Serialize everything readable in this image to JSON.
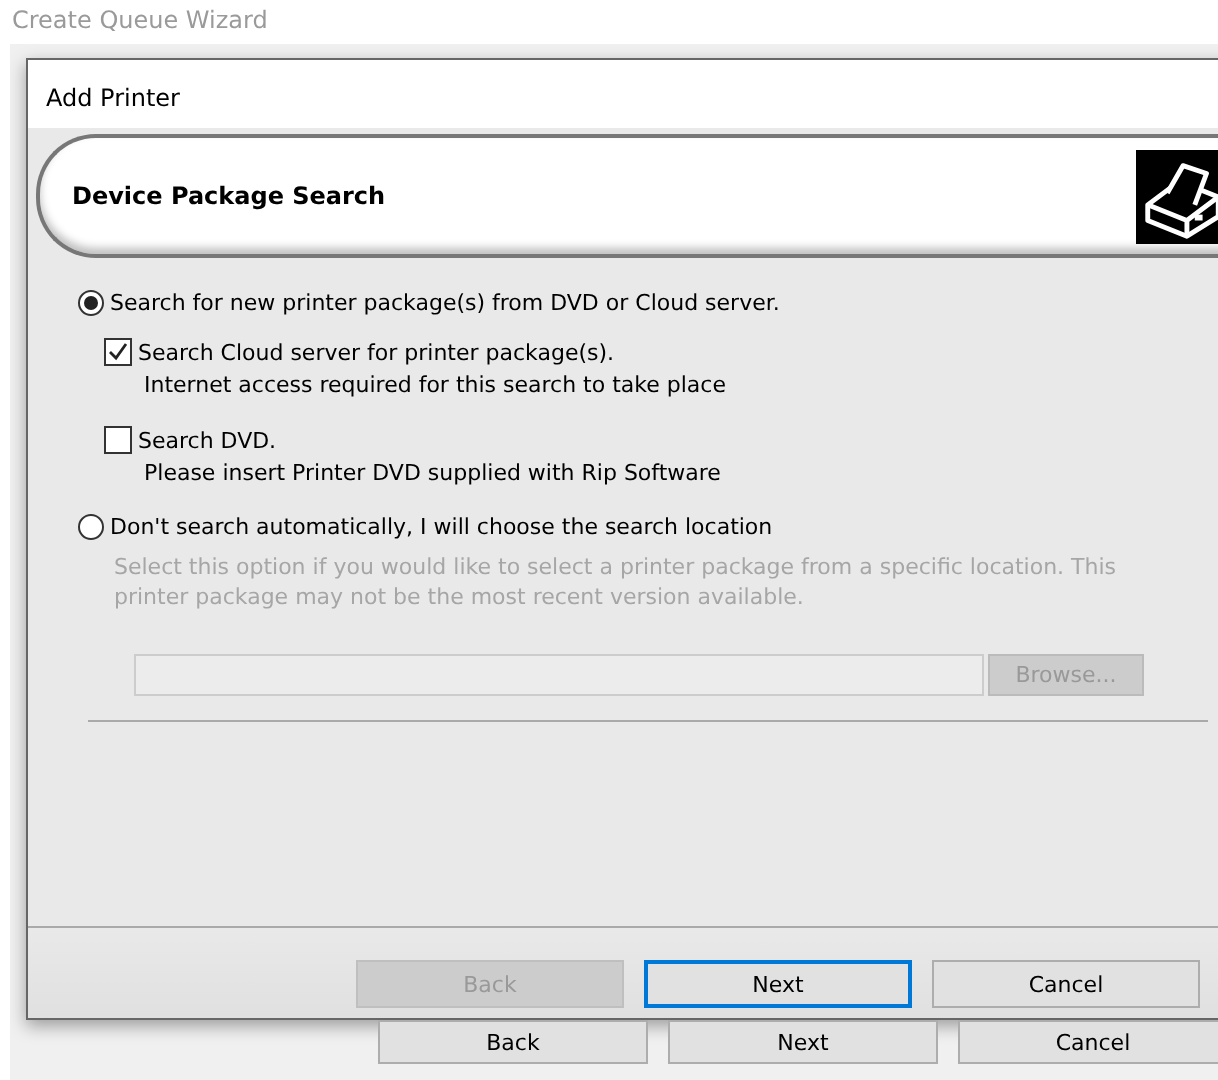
{
  "background_window": {
    "title": "Create Queue Wizard",
    "buttons": [
      {
        "label": "Back"
      },
      {
        "label": "Next"
      },
      {
        "label": "Cancel"
      }
    ]
  },
  "dialog": {
    "title": "Add Printer",
    "header": {
      "title": "Device Package Search"
    },
    "options": [
      {
        "label": "Search for new printer package(s) from DVD or Cloud server.",
        "selected": true,
        "sub_options": [
          {
            "label": "Search Cloud server for printer package(s).",
            "hint": "Internet access required for this search to take place",
            "checked": true
          },
          {
            "label": "Search DVD.",
            "hint": "Please insert Printer DVD supplied with Rip Software",
            "checked": false
          }
        ]
      },
      {
        "label": "Don't search automatically, I will choose the search location",
        "selected": false,
        "description": "Select this option if you would like to select a printer package from a specific location. This printer package may not be the most recent version available.",
        "location": {
          "disabled": true,
          "browse_label": "Browse..."
        }
      }
    ],
    "buttons": [
      {
        "label": "Back",
        "disabled": true,
        "focused": false
      },
      {
        "label": "Next",
        "disabled": false,
        "focused": true
      },
      {
        "label": "Cancel",
        "disabled": false,
        "focused": false
      }
    ]
  }
}
